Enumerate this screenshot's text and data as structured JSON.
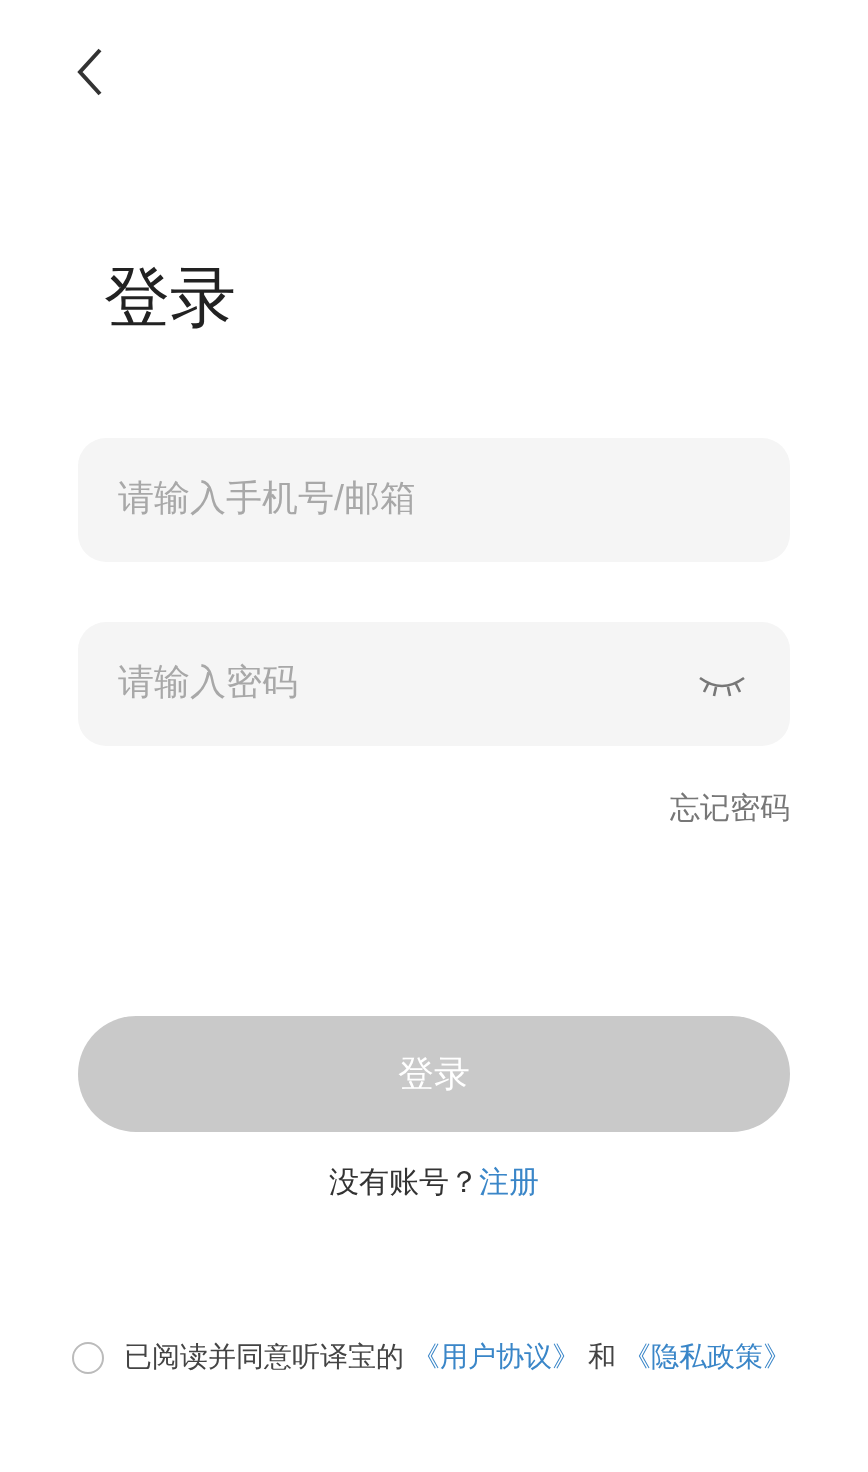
{
  "title": "登录",
  "fields": [
    {
      "kind": "text",
      "placeholder": "请输入手机号/邮箱"
    },
    {
      "kind": "password",
      "placeholder": "请输入密码",
      "password_visible": false
    }
  ],
  "forgot_link": "忘记密码",
  "login_button": {
    "label": "登录",
    "disabled": true
  },
  "register": {
    "prompt": "没有账号？",
    "link": "注册"
  },
  "agreement": {
    "checked": false,
    "text": "已阅读并同意听译宝的",
    "user_agreement": "《用户协议》",
    "connector": "和",
    "privacy_policy": "《隐私政策》"
  }
}
